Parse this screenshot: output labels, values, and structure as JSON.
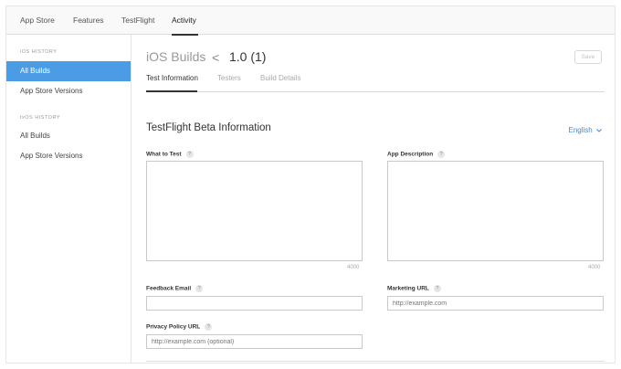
{
  "topnav": {
    "items": [
      "App Store",
      "Features",
      "TestFlight",
      "Activity"
    ]
  },
  "sidebar": {
    "ios_heading": "iOS HISTORY",
    "ios_items": [
      "All Builds",
      "App Store Versions"
    ],
    "tvos_heading": "tvOS HISTORY",
    "tvos_items": [
      "All Builds",
      "App Store Versions"
    ]
  },
  "header": {
    "title": "iOS Builds",
    "back_glyph": "<",
    "build": "1.0 (1)",
    "save_label": "Save"
  },
  "tabs": [
    "Test Information",
    "Testers",
    "Build Details"
  ],
  "section": {
    "title": "TestFlight Beta Information",
    "language": "English"
  },
  "form": {
    "what_to_test": {
      "label": "What to Test",
      "counter": "4000"
    },
    "app_description": {
      "label": "App Description",
      "counter": "4000"
    },
    "feedback_email": {
      "label": "Feedback Email",
      "value": ""
    },
    "marketing_url": {
      "label": "Marketing URL",
      "placeholder": "http://example.com"
    },
    "privacy_policy_url": {
      "label": "Privacy Policy URL",
      "placeholder": "http://example.com (optional)"
    },
    "help_glyph": "?"
  },
  "colors": {
    "accent": "#4a9de4",
    "link": "#3a8bd9"
  }
}
